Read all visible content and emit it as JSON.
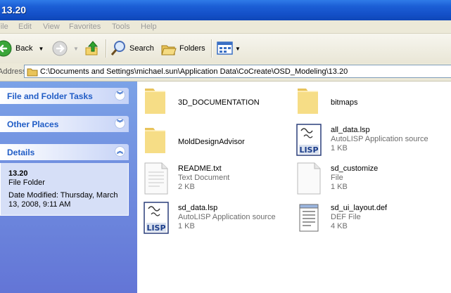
{
  "window": {
    "title": "13.20"
  },
  "menu": {
    "items": [
      "File",
      "Edit",
      "View",
      "Favorites",
      "Tools",
      "Help"
    ]
  },
  "toolbar": {
    "back_label": "Back",
    "search_label": "Search",
    "folders_label": "Folders"
  },
  "address": {
    "label": "Address",
    "path": "C:\\Documents and Settings\\michael.sun\\Application Data\\CoCreate\\OSD_Modeling\\13.20"
  },
  "taskpane": {
    "file_folder_tasks": "File and Folder Tasks",
    "other_places": "Other Places",
    "details": {
      "title": "Details",
      "name": "13.20",
      "type": "File Folder",
      "date_line1": "Date Modified: Thursday, March",
      "date_line2": "13, 2008, 9:11 AM"
    }
  },
  "files": [
    {
      "name": "3D_DOCUMENTATION",
      "type": "",
      "size": "",
      "icon": "folder"
    },
    {
      "name": "bitmaps",
      "type": "",
      "size": "",
      "icon": "folder"
    },
    {
      "name": "MoldDesignAdvisor",
      "type": "",
      "size": "",
      "icon": "folder"
    },
    {
      "name": "all_data.lsp",
      "type": "AutoLISP Application source",
      "size": "1 KB",
      "icon": "lisp"
    },
    {
      "name": "README.txt",
      "type": "Text Document",
      "size": "2 KB",
      "icon": "document"
    },
    {
      "name": "sd_customize",
      "type": "File",
      "size": "1 KB",
      "icon": "blank-file"
    },
    {
      "name": "sd_data.lsp",
      "type": "AutoLISP Application source",
      "size": "1 KB",
      "icon": "lisp"
    },
    {
      "name": "sd_ui_layout.def",
      "type": "DEF File",
      "size": "4 KB",
      "icon": "notepad-file"
    }
  ]
}
